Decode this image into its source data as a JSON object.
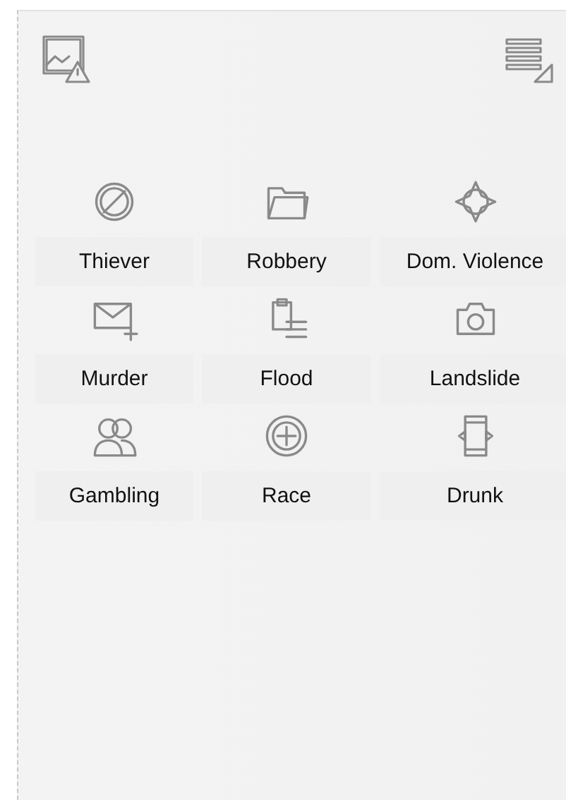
{
  "categories": [
    {
      "label": "Thiever"
    },
    {
      "label": "Robbery"
    },
    {
      "label": "Dom. Violence"
    },
    {
      "label": "Murder"
    },
    {
      "label": "Flood"
    },
    {
      "label": "Landslide"
    },
    {
      "label": "Gambling"
    },
    {
      "label": "Race"
    },
    {
      "label": "Drunk"
    }
  ]
}
